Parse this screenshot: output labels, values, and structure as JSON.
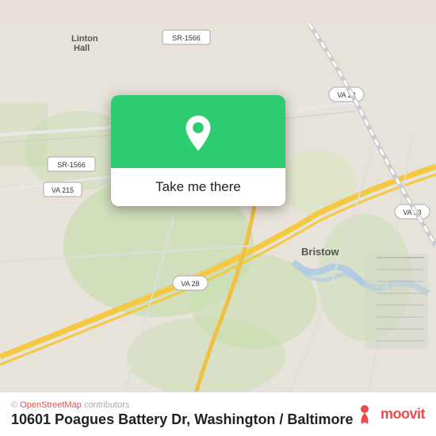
{
  "map": {
    "alt": "Map of Bristow Virginia area"
  },
  "popup": {
    "pin_icon": "location-pin",
    "button_label": "Take me there"
  },
  "bottom_bar": {
    "copyright_prefix": "© ",
    "copyright_link_text": "OpenStreetMap",
    "copyright_suffix": " contributors",
    "address": "10601 Poagues Battery Dr, Washington / Baltimore",
    "moovit_logo_text": "moovit"
  }
}
